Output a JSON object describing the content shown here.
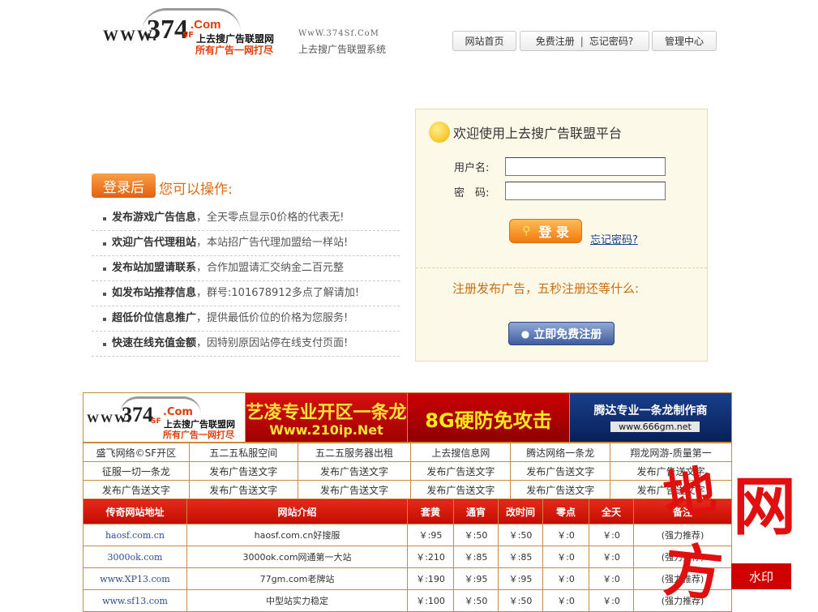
{
  "header": {
    "logo": {
      "www": "WWW.",
      "num": "374",
      "sf": "SF",
      "com": ".Com",
      "line1": "上去搜广告联盟网",
      "line2": "所有广告一网打尽"
    },
    "site_url": "WwW.374Sf.CoM",
    "site_subtitle": "上去搜广告联盟系统",
    "nav": {
      "home": "网站首页",
      "register": "免费注册",
      "sep": "|",
      "forgot": "忘记密码?",
      "admin": "管理中心"
    }
  },
  "ops": {
    "tag": "登录后",
    "tag_text": "您可以操作:",
    "items": [
      {
        "title": "发布游戏广告信息",
        "desc": "，全天零点显示0价格的代表无!"
      },
      {
        "title": "欢迎广告代理租站",
        "desc": "，本站招广告代理加盟给一样站!"
      },
      {
        "title": "发布站加盟请联系",
        "desc": "，合作加盟请汇交纳金二百元整"
      },
      {
        "title": "如发布站推荐信息",
        "desc": "，群号:101678912多点了解请加!"
      },
      {
        "title": "超低价位信息推广",
        "desc": "，提供最低价位的价格为您服务!"
      },
      {
        "title": "快速在线充值金额",
        "desc": "，因特别原因站停在线支付页面!"
      }
    ]
  },
  "login": {
    "title": "欢迎使用上去搜广告联盟平台",
    "username_label": "用户名:",
    "password_label": "密　码:",
    "username_value": "",
    "password_value": "",
    "login_button": "登 录",
    "forgot": "忘记密码?",
    "register_prompt": "注册发布广告，五秒注册还等什么:",
    "register_button": "立即免费注册"
  },
  "banners": {
    "b1": {
      "www": "WWW.",
      "num": "374",
      "sf": "SF",
      "com": ".Com",
      "line1": "上去搜广告联盟网",
      "line2": "所有广告一网打尽"
    },
    "b2": {
      "line1": "艺凌专业开区一条龙",
      "line2": "Www.210ip.Net"
    },
    "b3": {
      "line1": "8G硬防免攻击"
    },
    "b4": {
      "line1": "腾达专业一条龙制作商",
      "line2": "www.666gm.net"
    }
  },
  "links": [
    [
      "盛飞网络©SF开区",
      "五二五私服空间",
      "五二五服务器出租",
      "上去搜信息网",
      "腾达网络一条龙",
      "翔龙网游-质量第一"
    ],
    [
      "征服一切一条龙",
      "发布广告送文字",
      "发布广告送文字",
      "发布广告送文字",
      "发布广告送文字",
      "发布广告送文字"
    ],
    [
      "发布广告送文字",
      "发布广告送文字",
      "发布广告送文字",
      "发布广告送文字",
      "发布广告送文字",
      "发布广告送文字"
    ]
  ],
  "table": {
    "headers": [
      "传奇网站地址",
      "网站介绍",
      "套黄",
      "通宵",
      "改时间",
      "零点",
      "全天",
      "备注"
    ],
    "rows": [
      [
        "haosf.com.cn",
        "haosf.com.cn好搜服",
        "￥:95",
        "￥:50",
        "￥:50",
        "￥:0",
        "￥:0",
        "(强力推荐)"
      ],
      [
        "3000ok.com",
        "3000ok.com网通第一大站",
        "￥:210",
        "￥:85",
        "￥:85",
        "￥:0",
        "￥:0",
        "(强力推荐)"
      ],
      [
        "www.XP13.com",
        "77gm.com老牌站",
        "￥:190",
        "￥:95",
        "￥:95",
        "￥:0",
        "￥:0",
        "(强力推荐)"
      ],
      [
        "www.sf13.com",
        "中型站实力稳定",
        "￥:100",
        "￥:50",
        "￥:50",
        "￥:0",
        "￥:0",
        "(强力推荐)"
      ]
    ]
  },
  "watermark": {
    "c1": "地",
    "c2": "网",
    "c3": "方",
    "seal": "水印"
  }
}
